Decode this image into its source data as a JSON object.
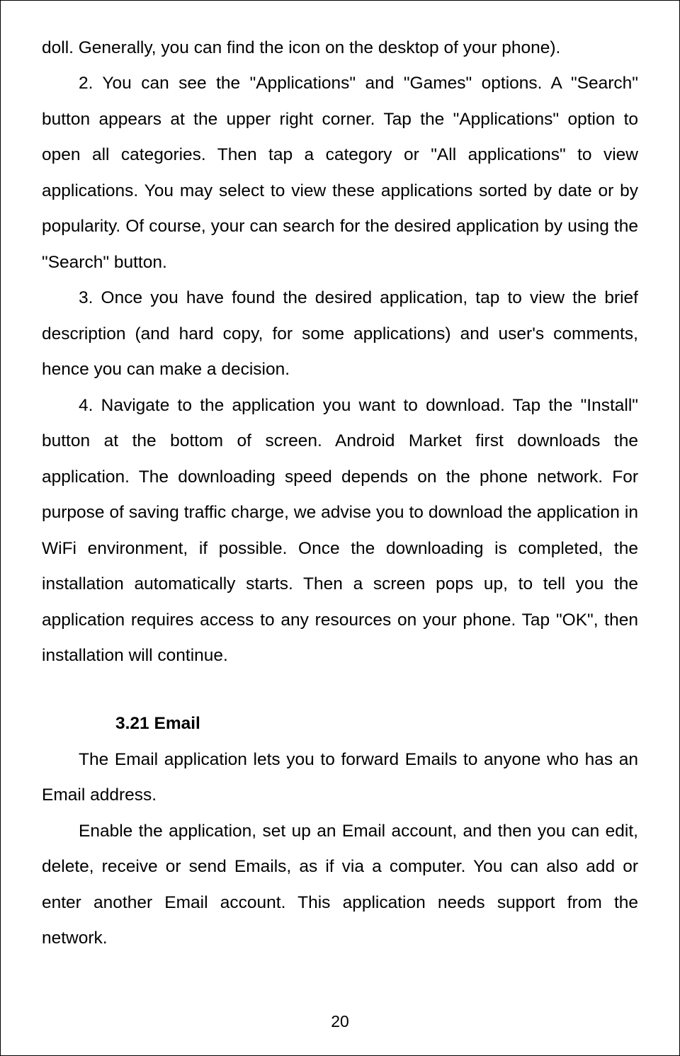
{
  "paragraphs": {
    "p1": "doll. Generally, you can find the icon on the desktop of your phone).",
    "p2": "2. You can see the \"Applications\" and \"Games\" options. A \"Search\" button appears at the upper right corner. Tap the \"Applications\" option to open all categories. Then tap a category or \"All applications\" to view applications. You may select to view these applications sorted by date or by popularity. Of course, your can search for the desired application by using the \"Search\" button.",
    "p3": "3. Once you have found the desired application, tap to view the brief description (and hard copy, for some applications) and user's comments, hence you can make a decision.",
    "p4": "4. Navigate to the application you want to download. Tap the \"Install\" button at the bottom of screen. Android Market first downloads the application. The downloading speed depends on the phone network. For purpose of saving traffic charge, we advise you to download the application in WiFi environment, if possible. Once the downloading is completed, the installation automatically starts. Then a screen pops up, to tell you the application requires access to any resources on your phone. Tap \"OK\", then installation will continue.",
    "heading_num": "3.21",
    "heading_title": "Email",
    "p5": "The Email application lets you to forward Emails to anyone who has an Email address.",
    "p6": "Enable the application, set up an Email account, and then you can edit, delete, receive or send Emails, as if via a computer. You can also add or enter another Email account. This application needs support from the network."
  },
  "page_number": "20"
}
